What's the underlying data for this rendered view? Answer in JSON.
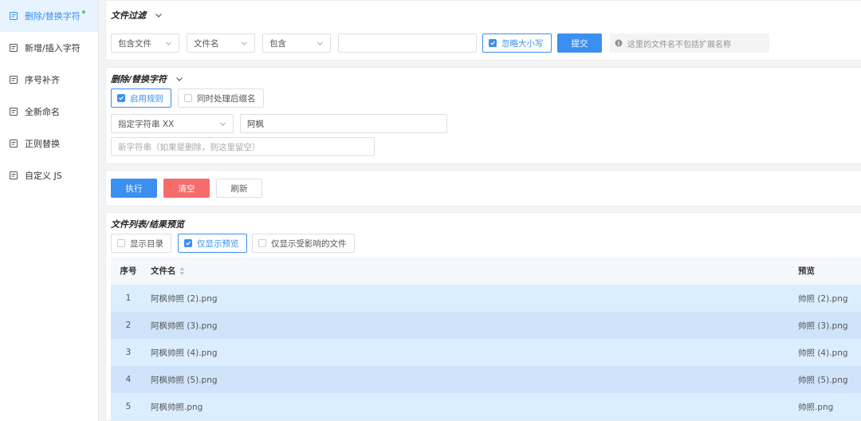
{
  "sidebar": {
    "items": [
      {
        "label": "删除/替换字符",
        "active": true,
        "dot": true
      },
      {
        "label": "新增/插入字符"
      },
      {
        "label": "序号补齐"
      },
      {
        "label": "全新命名"
      },
      {
        "label": "正则替换"
      },
      {
        "label": "自定义 JS"
      }
    ]
  },
  "filter": {
    "title": "文件过滤",
    "select_scope": "包含文件",
    "select_target": "文件名",
    "select_op": "包含",
    "match_value": "",
    "ignore_case_label": "忽略大小写",
    "submit_label": "提交",
    "hint": "这里的文件名不包括扩展名称"
  },
  "rule": {
    "title": "删除/替换字符",
    "enable_label": "启用规则",
    "suffix_label": "同时处理后缀名",
    "mode_select": "指定字符串 XX",
    "find_value": "阿枫",
    "replace_placeholder": "新字符串（如果是删除，则这里留空）"
  },
  "actions": {
    "execute": "执行",
    "clear": "清空",
    "refresh": "刷新"
  },
  "preview": {
    "title": "文件列表/结果预览",
    "show_dirs": "显示目录",
    "only_preview": "仅显示预览",
    "only_affected": "仅显示受影响的文件",
    "columns": {
      "no": "序号",
      "name": "文件名",
      "preview": "预览"
    },
    "rows": [
      {
        "no": "1",
        "name": "阿枫帅照 (2).png",
        "preview": "帅照 (2).png"
      },
      {
        "no": "2",
        "name": "阿枫帅照 (3).png",
        "preview": "帅照 (3).png"
      },
      {
        "no": "3",
        "name": "阿枫帅照 (4).png",
        "preview": "帅照 (4).png"
      },
      {
        "no": "4",
        "name": "阿枫帅照 (5).png",
        "preview": "帅照 (5).png"
      },
      {
        "no": "5",
        "name": "阿枫帅照.png",
        "preview": "帅照.png"
      }
    ]
  },
  "colors": {
    "accent": "#3b8ff0",
    "danger": "#f56c6c",
    "row_a": "#dbeeff",
    "row_b": "#cfe4fb"
  }
}
